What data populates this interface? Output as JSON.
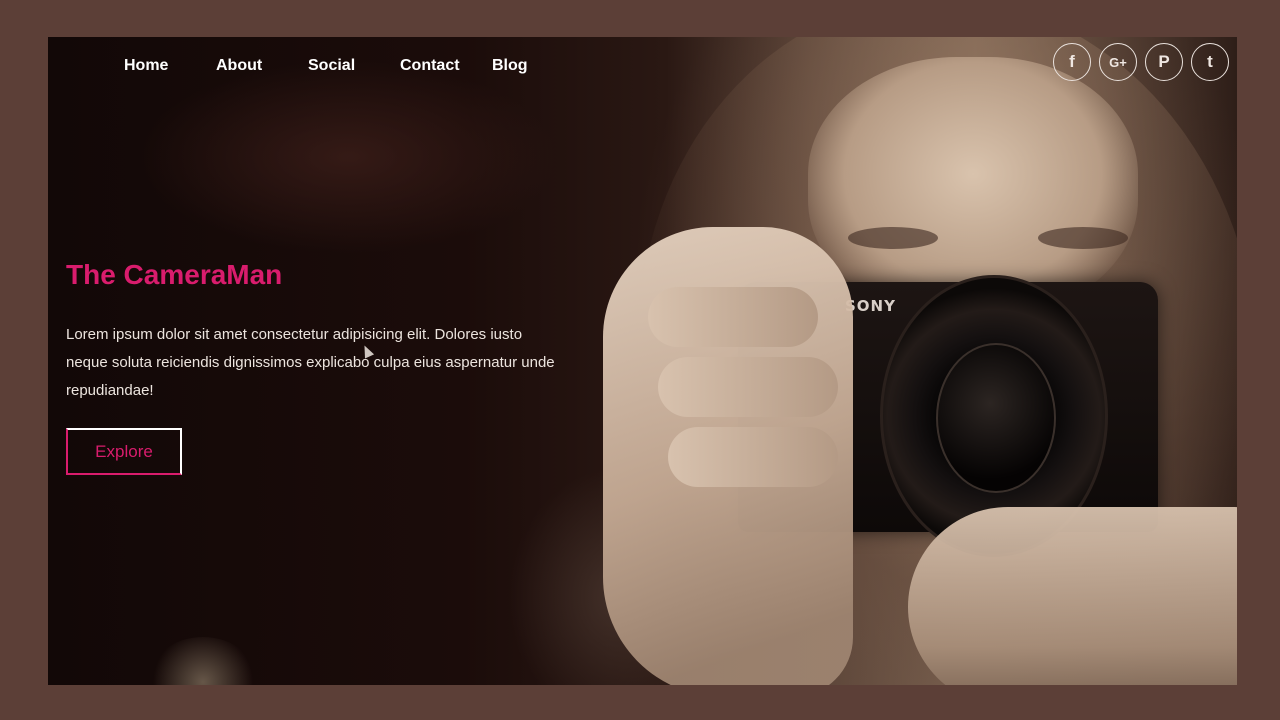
{
  "nav": {
    "items": [
      "Home",
      "About",
      "Social",
      "Contact",
      "Blog"
    ]
  },
  "social": {
    "facebook": "f",
    "google_plus": "G+",
    "pinterest": "P",
    "twitter": "t",
    "icons": [
      "facebook-icon",
      "google-plus-icon",
      "pinterest-icon",
      "twitter-icon"
    ]
  },
  "hero": {
    "title": "The CameraMan",
    "text": "Lorem ipsum dolor sit amet consectetur adipisicing elit. Dolores iusto neque soluta reiciendis dignissimos explicabo culpa eius aspernatur unde repudiandae!",
    "button_label": "Explore"
  },
  "camera": {
    "brand": "SONY"
  },
  "colors": {
    "accent": "#d91c6d",
    "page_background": "#5c3f37",
    "text": "#ffffff"
  }
}
